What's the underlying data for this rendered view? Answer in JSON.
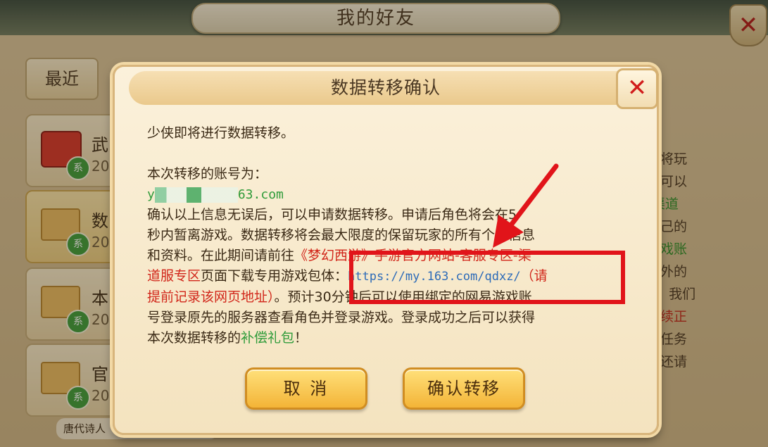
{
  "background": {
    "title": "我的好友",
    "close_icon": "close-icon",
    "tab_recent": "最近",
    "list": [
      {
        "name": "武",
        "date": "202",
        "icon": "gift-icon",
        "badge": "系"
      },
      {
        "name": "数",
        "date": "202",
        "icon": "envelope-icon",
        "badge": "系"
      },
      {
        "name": "本",
        "date": "202",
        "icon": "envelope-icon",
        "badge": "系"
      },
      {
        "name": "官",
        "date": "202",
        "icon": "envelope-icon",
        "badge": "系"
      }
    ],
    "right_text": {
      "l1": "需要将玩",
      "l2": "成后可以",
      "l3": "区-渠道",
      "l4": "续自己的",
      "l5": "易游戏账",
      "l6": "得额外的",
      "l7": "5点，我们",
      "l8": "去继续正",
      "l9": "师门任务",
      "l10": "不便还请"
    },
    "bottom_hint": "唐代诗人"
  },
  "dialog": {
    "title": "数据转移确认",
    "close_icon": "close-icon",
    "line1": "少侠即将进行数据转移。",
    "account_label": "本次转移的账号为：",
    "account_prefix": "y",
    "account_suffix": "63.com",
    "p2_a": "确认以上信息无误后，可以申请数据转移。申请后角色将会在5",
    "p2_b": "秒内暂离游戏。数据转移将会最大限度的保留玩家的所有个人信息",
    "p2_c": "和资料。在此期间请前往",
    "p2_red1": "《梦幻西游》手游官方网站-客服专区-渠",
    "p2_red2": "道服专区",
    "p2_d": "页面下载专用游戏包体：",
    "url": "https://my.163.com/qdxz/",
    "p2_red3": "（请",
    "p2_red4": "提前记录该网页地址）",
    "p2_e": "。预计30分钟后可以使用绑定的网易游戏账",
    "p2_f": "号登录原先的服务器查看角色并登录游戏。登录成功之后可以获得",
    "p2_g": "本次数据转移的",
    "p2_green": "补偿礼包",
    "p2_h": "！",
    "cancel_label": "取 消",
    "confirm_label": "确认转移"
  },
  "colors": {
    "annotation_red": "#e1141a",
    "link_blue": "#2d6bb8",
    "warn_red": "#d1261a",
    "gift_green": "#2f9b3a",
    "button_gold": "#f3b437"
  }
}
